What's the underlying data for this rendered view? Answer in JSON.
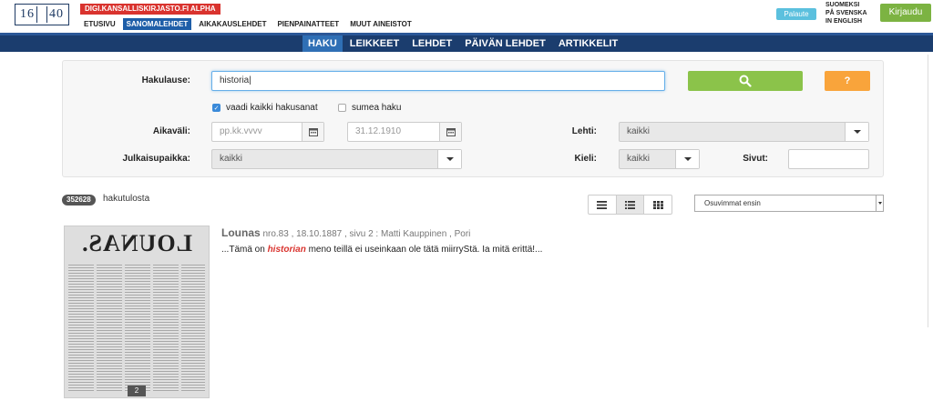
{
  "header": {
    "logo_left": "16",
    "logo_right": "40",
    "site_badge": "DIGI.KANSALLISKIRJASTO.FI ALPHA",
    "nav": [
      "ETUSIVU",
      "SANOMALEHDET",
      "AIKAKAUSLEHDET",
      "PIENPAINATTEET",
      "MUUT AINEISTOT"
    ],
    "active_nav": "SANOMALEHDET",
    "feedback_label": "Palaute",
    "languages": [
      "SUOMEKSI",
      "PÅ SVENSKA",
      "IN ENGLISH"
    ],
    "login_label": "Kirjaudu"
  },
  "subnav": {
    "items": [
      "HAKU",
      "LEIKKEET",
      "LEHDET",
      "PÄIVÄN LEHDET",
      "ARTIKKELIT"
    ],
    "active": "HAKU"
  },
  "search": {
    "query_label": "Hakulause:",
    "query_value": "historia|",
    "search_icon": "magnifier-icon",
    "help_label": "?",
    "checkbox_all_terms": "vaadi kaikki hakusanat",
    "checkbox_all_terms_checked": true,
    "checkbox_fuzzy": "sumea haku",
    "checkbox_fuzzy_checked": false,
    "period_label": "Aikaväli:",
    "date_from_placeholder": "pp.kk.vvvv",
    "date_to_value": "31.12.1910",
    "paper_label": "Lehti:",
    "paper_value": "kaikki",
    "place_label": "Julkaisupaikka:",
    "place_value": "kaikki",
    "language_label": "Kieli:",
    "language_value": "kaikki",
    "pages_label": "Sivut:",
    "pages_value": ""
  },
  "results": {
    "count": "352628",
    "count_text": "hakutulosta",
    "sort_value": "Osuvimmat ensin",
    "items": [
      {
        "thumb_title": "LOUNAS.",
        "page_badge": "2",
        "title": "Lounas",
        "meta": "nro.83 , 18.10.1887 , sivu 2 : Matti Kauppinen , Pori",
        "snippet_before": "...Tämä on ",
        "snippet_highlight": "historian",
        "snippet_after": " meno teillä ei useinkaan ole tätä miirryStä. Ia mitä erittä!..."
      }
    ]
  },
  "colors": {
    "brand_blue": "#1b3d6e",
    "active_tab": "#1e5ea8",
    "search_button": "#8bc34a",
    "help_button": "#f9a43b",
    "login_button": "#7cb342",
    "badge_red": "#d9332e",
    "highlight": "#d9332e"
  }
}
